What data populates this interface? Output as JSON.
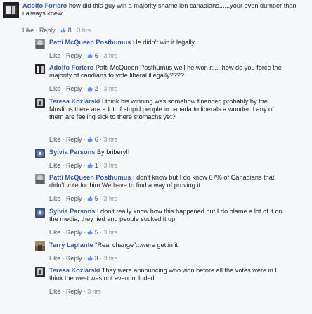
{
  "ui": {
    "like": "Like",
    "reply": "Reply",
    "sep": "·"
  },
  "comments": [
    {
      "author": "Adolfo Foriero",
      "text": "how did this guy win a majority shame ion canadians......your even dumber than i always knew.",
      "likes": "8",
      "time": "3 hrs"
    },
    {
      "author": "Patti McQueen Posthumus",
      "text": "He didn't win it legally",
      "likes": "6",
      "time": "3 hrs"
    },
    {
      "author": "Adolfo Foriero",
      "text": "Patti McQueen Posthumus well he won it.....how do you force the majority of candians to vote liberal illegally????",
      "likes": "2",
      "time": "3 hrs"
    },
    {
      "author": "Teresa Koziarski",
      "text": "I think his winning was somehow financed probably by the Muslims there are a lot of stupid people in canada to liberals a wonder if any of them are feeling sick to there stomachs yet?",
      "likes": "6",
      "time": "3 hrs"
    },
    {
      "author": "Sylvia Parsons",
      "text": "By bribery!!",
      "likes": "1",
      "time": "3 hrs"
    },
    {
      "author": "Patti McQueen Posthumus",
      "text": "I don't know but I do know 67% of Canadians that didn't vote for him.We have to find a way of proving it.",
      "likes": "5",
      "time": "3 hrs"
    },
    {
      "author": "Sylvia Parsons",
      "text": "I don't really know how this happened but I do blame a lot of it on the media, they lied and people sucked it up!",
      "likes": "5",
      "time": "3 hrs"
    },
    {
      "author": "Terry Laplante",
      "text": "\"Real change\"...were gettin it",
      "likes": "3",
      "time": "3 hrs"
    },
    {
      "author": "Teresa Koziarski",
      "text": "Thay were announcing who won before all the votes were in I think the west was not even included",
      "likes": "",
      "time": "3 hrs"
    }
  ]
}
